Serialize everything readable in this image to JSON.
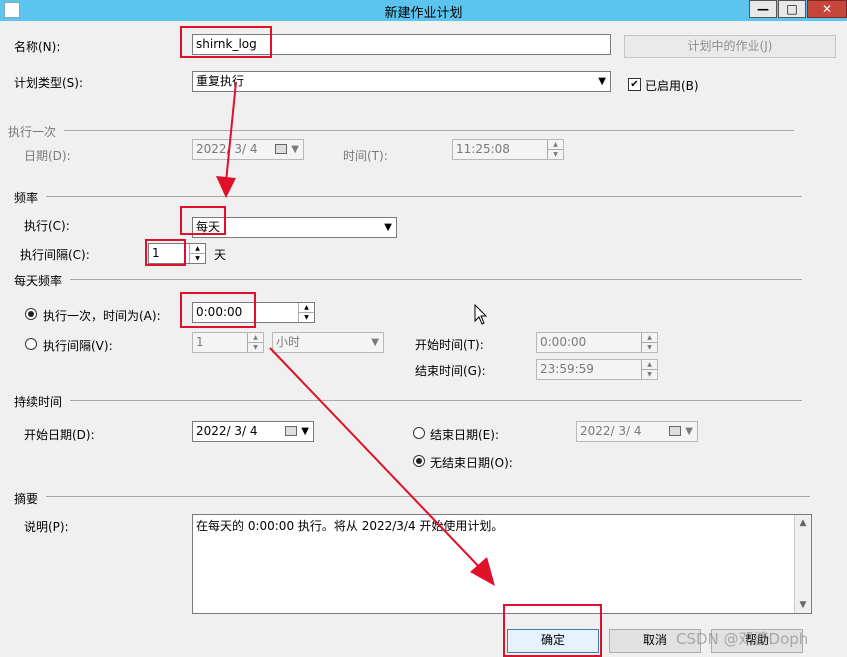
{
  "window": {
    "title": "新建作业计划",
    "minimize": "—",
    "maximize": "□",
    "close": "✕"
  },
  "name_label": "名称(N):",
  "name_value": "shirnk_log",
  "jobs_in_schedule_button": "计划中的作业(J)",
  "schedule_type_label": "计划类型(S):",
  "schedule_type_value": "重复执行",
  "enabled_label": "已启用(B)",
  "one_time": {
    "header": "执行一次",
    "date_label": "日期(D):",
    "date_value": "2022/ 3/ 4",
    "time_label": "时间(T):",
    "time_value": "11:25:08"
  },
  "frequency": {
    "header": "频率",
    "occurs_label": "执行(C):",
    "occurs_value": "每天",
    "recurs_label": "执行间隔(C):",
    "recurs_value": "1",
    "recurs_unit": "天"
  },
  "daily": {
    "header": "每天频率",
    "once_label": "执行一次，时间为(A):",
    "once_time": "0:00:00",
    "every_label": "执行间隔(V):",
    "every_value": "1",
    "every_unit": "小时",
    "start_label": "开始时间(T):",
    "start_value": "0:00:00",
    "end_label": "结束时间(G):",
    "end_value": "23:59:59"
  },
  "duration": {
    "header": "持续时间",
    "start_date_label": "开始日期(D):",
    "start_date_value": "2022/ 3/ 4",
    "end_date_label": "结束日期(E):",
    "end_date_value": "2022/ 3/ 4",
    "no_end_label": "无结束日期(O):"
  },
  "summary": {
    "header": "摘要",
    "desc_label": "说明(P):",
    "desc_text": "在每天的 0:00:00 执行。将从 2022/3/4 开始使用计划。"
  },
  "buttons": {
    "ok": "确定",
    "cancel": "取消",
    "help": "帮助"
  },
  "watermark": "CSDN @邓婆Doph",
  "colors": {
    "titlebar": "#5bc5f0",
    "annotation_red": "#e0102a"
  }
}
